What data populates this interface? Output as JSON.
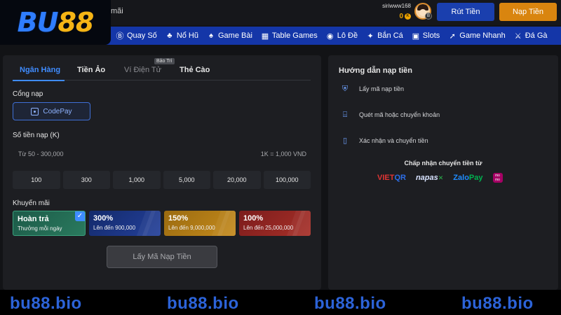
{
  "header": {
    "promo_text": "mãi",
    "username": "siriwww168",
    "balance": "0",
    "coin_symbol": "K",
    "avatar_badge": "B",
    "withdraw_label": "Rút Tiền",
    "deposit_label": "Nạp Tiền"
  },
  "logo": {
    "part1": "BU",
    "part2": "88"
  },
  "nav": {
    "items": [
      {
        "icon": "Ⓑ",
        "label": "Quay Số"
      },
      {
        "icon": "♣",
        "label": "Nổ Hũ"
      },
      {
        "icon": "♠",
        "label": "Game Bài"
      },
      {
        "icon": "▦",
        "label": "Table Games"
      },
      {
        "icon": "◉",
        "label": "Lô Đề"
      },
      {
        "icon": "✦",
        "label": "Bắn Cá"
      },
      {
        "icon": "▣",
        "label": "Slots"
      },
      {
        "icon": "➚",
        "label": "Game Nhanh"
      },
      {
        "icon": "⚔",
        "label": "Đá Gà"
      }
    ]
  },
  "deposit": {
    "tabs": [
      {
        "label": "Ngân Hàng"
      },
      {
        "label": "Tiền Ảo"
      },
      {
        "label": "Ví Điện Tử"
      },
      {
        "label": "Thẻ Cào"
      }
    ],
    "maintenance_badge": "Bảo Trì",
    "gateway_label": "Cổng nạp",
    "gateway_option": "CodePay",
    "amount_label": "Số tiền nạp (K)",
    "amount_placeholder": "Từ 50 - 300,000",
    "rate_text": "1K = 1,000 VND",
    "quick_amounts": [
      "100",
      "300",
      "1,000",
      "5,000",
      "20,000",
      "100,000"
    ],
    "promo_label": "Khuyến mãi",
    "promos": [
      {
        "title": "Hoàn trả",
        "subtitle": "Thưởng mỗi ngày"
      },
      {
        "title": "300%",
        "subtitle": "Lên đến 900,000"
      },
      {
        "title": "150%",
        "subtitle": "Lên đến 9,000,000"
      },
      {
        "title": "100%",
        "subtitle": "Lên đến 25,000,000"
      }
    ],
    "submit_label": "Lấy Mã Nạp Tiền"
  },
  "guide": {
    "title": "Hướng dẫn nạp tiền",
    "steps": [
      {
        "label": "Lấy mã nạp tiền"
      },
      {
        "label": "Quét mã hoặc chuyển khoản"
      },
      {
        "label": "Xác nhận và chuyển tiền"
      }
    ],
    "accept_title": "Chấp nhận chuyển tiền từ",
    "partners": {
      "vietqr_a": "VIET",
      "vietqr_b": "QR",
      "napas": "napas",
      "zalo_a": "Zalo",
      "zalo_b": "Pay",
      "momo_a": "mo",
      "momo_b": "mo"
    }
  },
  "watermark": "bu88.bio"
}
